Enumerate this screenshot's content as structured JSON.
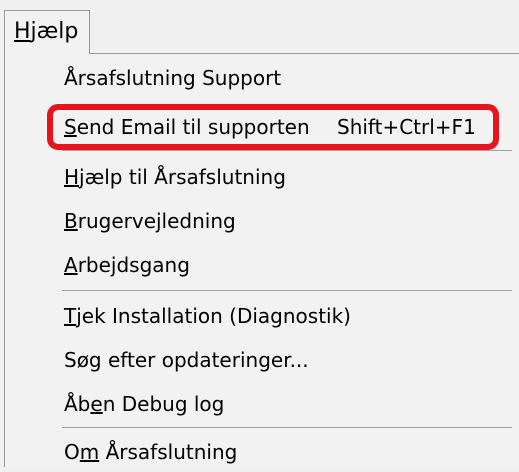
{
  "menu": {
    "title_mnemonic": "H",
    "title_rest": "jælp"
  },
  "items": [
    {
      "pre": "",
      "mnemonic": "",
      "post": "Årsafslutning Support"
    },
    {
      "pre": "",
      "mnemonic": "S",
      "post": "end Email til supporten",
      "shortcut": "Shift+Ctrl+F1"
    },
    {
      "pre": "",
      "mnemonic": "H",
      "post": "jælp til Årsafslutning"
    },
    {
      "pre": "",
      "mnemonic": "B",
      "post": "rugervejledning"
    },
    {
      "pre": "",
      "mnemonic": "A",
      "post": "rbejdsgang"
    },
    {
      "pre": "",
      "mnemonic": "T",
      "post": "jek Installation (Diagnostik)"
    },
    {
      "pre": "Søg efter opdateringer...",
      "mnemonic": "",
      "post": ""
    },
    {
      "pre": "Åb",
      "mnemonic": "e",
      "post": "n Debug log"
    },
    {
      "pre": "O",
      "mnemonic": "m",
      "post": " Årsafslutning"
    }
  ],
  "colors": {
    "highlight_border": "#e8141c",
    "menu_background": "#f2f2f2",
    "separator": "#a0a0a0"
  }
}
